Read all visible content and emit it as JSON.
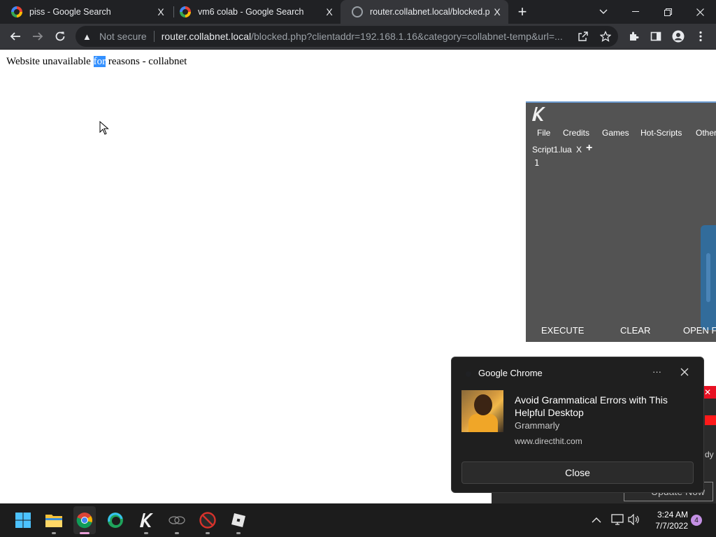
{
  "browser": {
    "tabs": [
      {
        "title": "piss - Google Search",
        "active": false
      },
      {
        "title": "vm6 colab - Google Search",
        "active": false
      },
      {
        "title": "router.collabnet.local/blocked.ph",
        "active": true
      }
    ],
    "new_tab_label": "+",
    "tab_close_label": "X",
    "security_label": "Not secure",
    "url_host": "router.collabnet.local",
    "url_path": "/blocked.php?clientaddr=192.168.1.16&category=collabnet-temp&url=..."
  },
  "page": {
    "message_before": "Website unavailable ",
    "message_highlight": "for",
    "message_after": " reasons - collabnet"
  },
  "krnl": {
    "logo": "K",
    "menu": [
      "File",
      "Credits",
      "Games",
      "Hot-Scripts",
      "Other"
    ],
    "tab_name": "Script1.lua",
    "tab_close": "X",
    "tab_add": "+",
    "line_number": "1",
    "buttons": {
      "execute": "EXECUTE",
      "clear": "CLEAR",
      "open": "OPEN F"
    }
  },
  "notification": {
    "app_name": "Google Chrome",
    "more": "···",
    "title": "Avoid Grammatical Errors with This Helpful Desktop",
    "source": "Grammarly",
    "url": "www.directhit.com",
    "close_button": "Close"
  },
  "behind_window": {
    "close": "✕",
    "fragment_text": "dy",
    "button_text": "Update Now"
  },
  "taskbar": {
    "time": "3:24 AM",
    "date": "7/7/2022",
    "notification_count": "4"
  },
  "colors": {
    "chrome_dark": "#202124",
    "chrome_toolbar": "#35363a",
    "selection": "#3390ff",
    "krnl_bg": "#535353",
    "taskbar": "#1c1c1c"
  }
}
